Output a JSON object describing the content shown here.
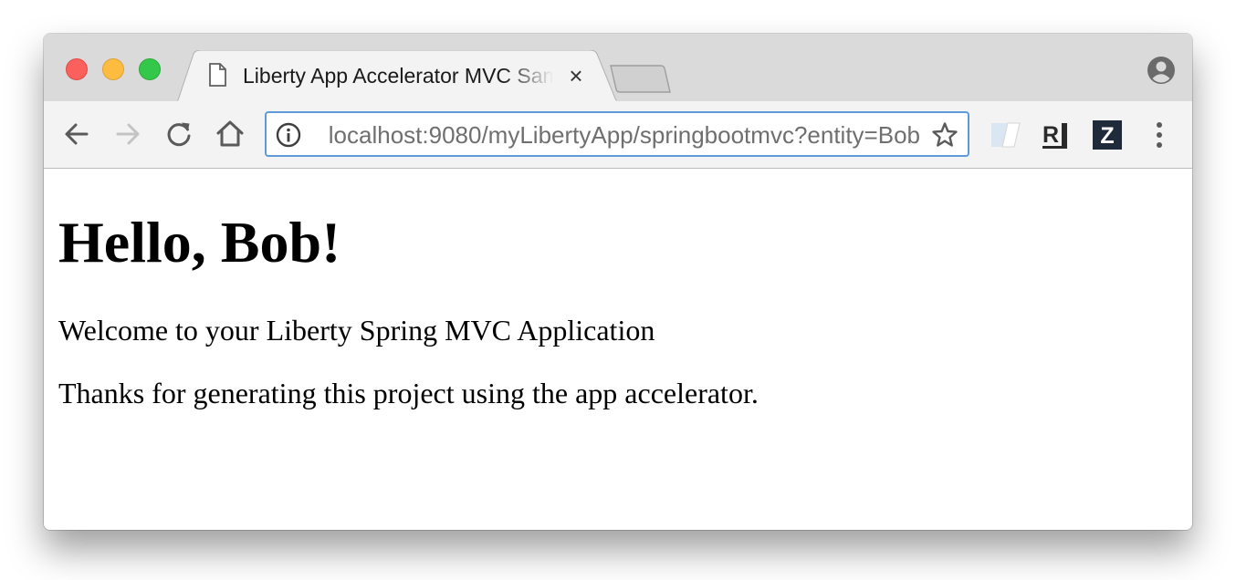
{
  "browser": {
    "tab": {
      "title": "Liberty App Accelerator MVC Sample",
      "close_glyph": "×",
      "icon": "document-icon"
    },
    "toolbar": {
      "icons": [
        "back-icon",
        "forward-icon",
        "reload-icon",
        "home-icon"
      ],
      "forward_enabled": false
    },
    "address_bar": {
      "url": "localhost:9080/myLibertyApp/springbootmvc?entity=Bob",
      "info_icon": "info-icon",
      "bookmark_icon": "star-icon"
    },
    "extensions": [
      {
        "name": "extension-icon"
      },
      {
        "name": "r-extension-icon",
        "label": "R"
      },
      {
        "name": "z-extension-icon",
        "label": "Z"
      }
    ],
    "profile_icon": "profile-icon",
    "menu_icon": "kebab-menu-icon"
  },
  "colors": {
    "titlebar": "#dadada",
    "toolbar": "#f3f3f3",
    "omnibox_focus": "#5e9ad8",
    "close": "#fc605c",
    "minimize": "#fdbc40",
    "maximize": "#34c84a"
  },
  "page": {
    "heading": "Hello, Bob!",
    "paragraphs": [
      "Welcome to your Liberty Spring MVC Application",
      "Thanks for generating this project using the app accelerator."
    ]
  }
}
